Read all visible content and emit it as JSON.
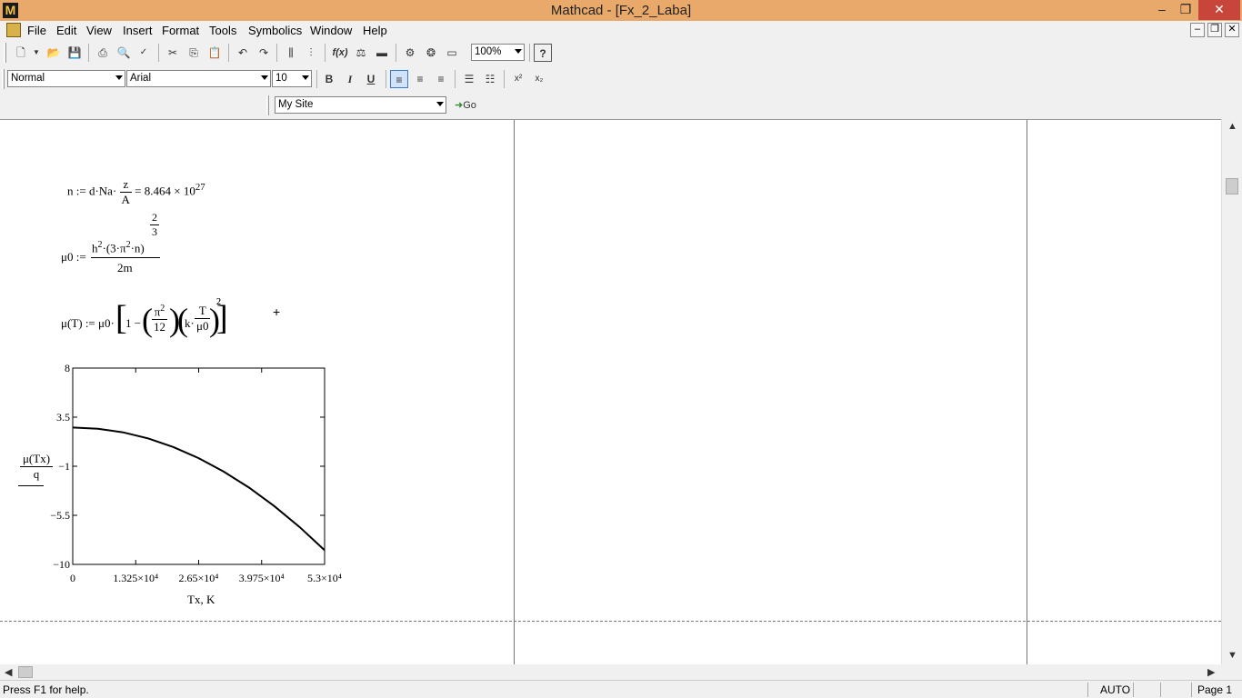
{
  "window": {
    "title": "Mathcad - [Fx_2_Laba]",
    "app_icon": "M",
    "minimize": "–",
    "restore": "❐",
    "close": "✕"
  },
  "menu": {
    "items": [
      "File",
      "Edit",
      "View",
      "Insert",
      "Format",
      "Tools",
      "Symbolics",
      "Window",
      "Help"
    ],
    "mdi_minimize": "–",
    "mdi_restore": "❐",
    "mdi_close": "✕"
  },
  "toolbar": {
    "zoom": "100%",
    "style": "Normal",
    "font": "Arial",
    "font_size": "10",
    "bold": "B",
    "italic": "I",
    "underline": "U",
    "superscript": "x²",
    "subscript": "x₂",
    "site": "My Site",
    "go": "Go"
  },
  "worksheet": {
    "eq1": {
      "lhs": "n := d·Na·",
      "num": "z",
      "den": "A",
      "result": "= 8.464 × 10",
      "exp": "27"
    },
    "eq2": {
      "lhs": "μ0 :=",
      "num_a": "h",
      "sq": "2",
      "num_b": "·(3·π",
      "num_c": "·n)",
      "exp_num": "2",
      "exp_den": "3",
      "den": "2m"
    },
    "eq3": {
      "lhs": "μ(T) := μ0·",
      "one": "1 −",
      "pi": "π",
      "sq": "2",
      "twelve": "12",
      "k": "k·",
      "T": "T",
      "mu0": "μ0",
      "outer_exp": "2"
    },
    "cursor": "+",
    "plot": {
      "y_label_num": "μ(Tx)",
      "y_label_den": "q",
      "x_label": "Tx, K"
    }
  },
  "chart_data": {
    "type": "line",
    "xlabel": "Tx, K",
    "ylabel": "μ(Tx) / q",
    "xlim": [
      0,
      53000
    ],
    "ylim": [
      -10,
      8
    ],
    "x_ticks": [
      "0",
      "1.325×10⁴",
      "2.65×10⁴",
      "3.975×10⁴",
      "5.3×10⁴"
    ],
    "y_ticks": [
      "8",
      "3.5",
      "−1",
      "−5.5",
      "−10"
    ],
    "series": [
      {
        "x": [
          0,
          5300,
          10600,
          15900,
          21200,
          26500,
          31800,
          37100,
          42400,
          47700,
          53000
        ],
        "values": [
          2.55,
          2.43,
          2.11,
          1.55,
          0.76,
          -0.26,
          -1.5,
          -2.96,
          -4.65,
          -6.56,
          -8.7
        ]
      }
    ]
  },
  "status": {
    "help": "Press F1 for help.",
    "mode": "AUTO",
    "page": "Page 1"
  }
}
